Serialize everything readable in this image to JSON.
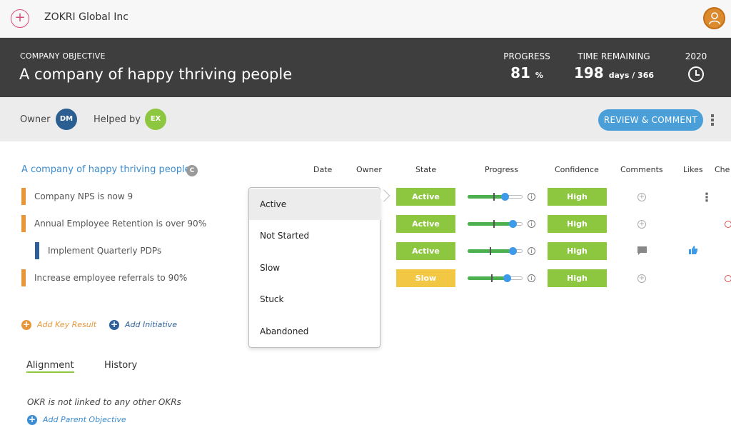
{
  "header": {
    "org_name": "ZOKRI Global Inc"
  },
  "objective": {
    "label": "COMPANY OBJECTIVE",
    "title": "A company of happy thriving people",
    "progress_label": "PROGRESS",
    "progress_value": "81",
    "progress_unit": "%",
    "time_label": "TIME REMAINING",
    "time_value": "198",
    "time_unit": "days / 366",
    "year": "2020"
  },
  "owner_bar": {
    "owner_label": "Owner",
    "owner_initials": "DM",
    "helped_label": "Helped by",
    "helper_initials": "EX",
    "review_button": "REVIEW & COMMENT"
  },
  "table": {
    "objective_link": "A company of happy thriving people",
    "objective_badge": "C",
    "columns": [
      "Date",
      "Owner",
      "State",
      "Progress",
      "Confidence",
      "Comments",
      "Likes",
      "Che"
    ],
    "rows": [
      {
        "name": "Company NPS is now 9",
        "state": "Active",
        "progress": 0.68,
        "confidence": "High",
        "bar_color": "#e8963a"
      },
      {
        "name": "Annual Employee Retention is over 90%",
        "state": "Active",
        "progress": 0.82,
        "confidence": "High",
        "bar_color": "#e8963a"
      },
      {
        "name": "Implement Quarterly PDPs",
        "state": "Active",
        "progress": 0.82,
        "confidence": "High",
        "bar_color": "#2f5f9a"
      },
      {
        "name": "Increase employee referrals to 90%",
        "state": "Slow",
        "progress": 0.72,
        "confidence": "High",
        "bar_color": "#e8963a"
      }
    ]
  },
  "state_dropdown": {
    "options": [
      "Active",
      "Not Started",
      "Slow",
      "Stuck",
      "Abandoned"
    ],
    "selected": "Active"
  },
  "actions": {
    "add_key_result": "Add Key Result",
    "add_initiative": "Add Initiative"
  },
  "tabs": {
    "alignment": "Alignment",
    "history": "History"
  },
  "alignment": {
    "empty_text": "OKR is not linked to any other OKRs",
    "add_parent": "Add Parent Objective"
  },
  "colors": {
    "active": "#8dc63f",
    "slow": "#f2c744",
    "accent": "#4a9fd8",
    "dark_header": "#3e3e3e"
  }
}
